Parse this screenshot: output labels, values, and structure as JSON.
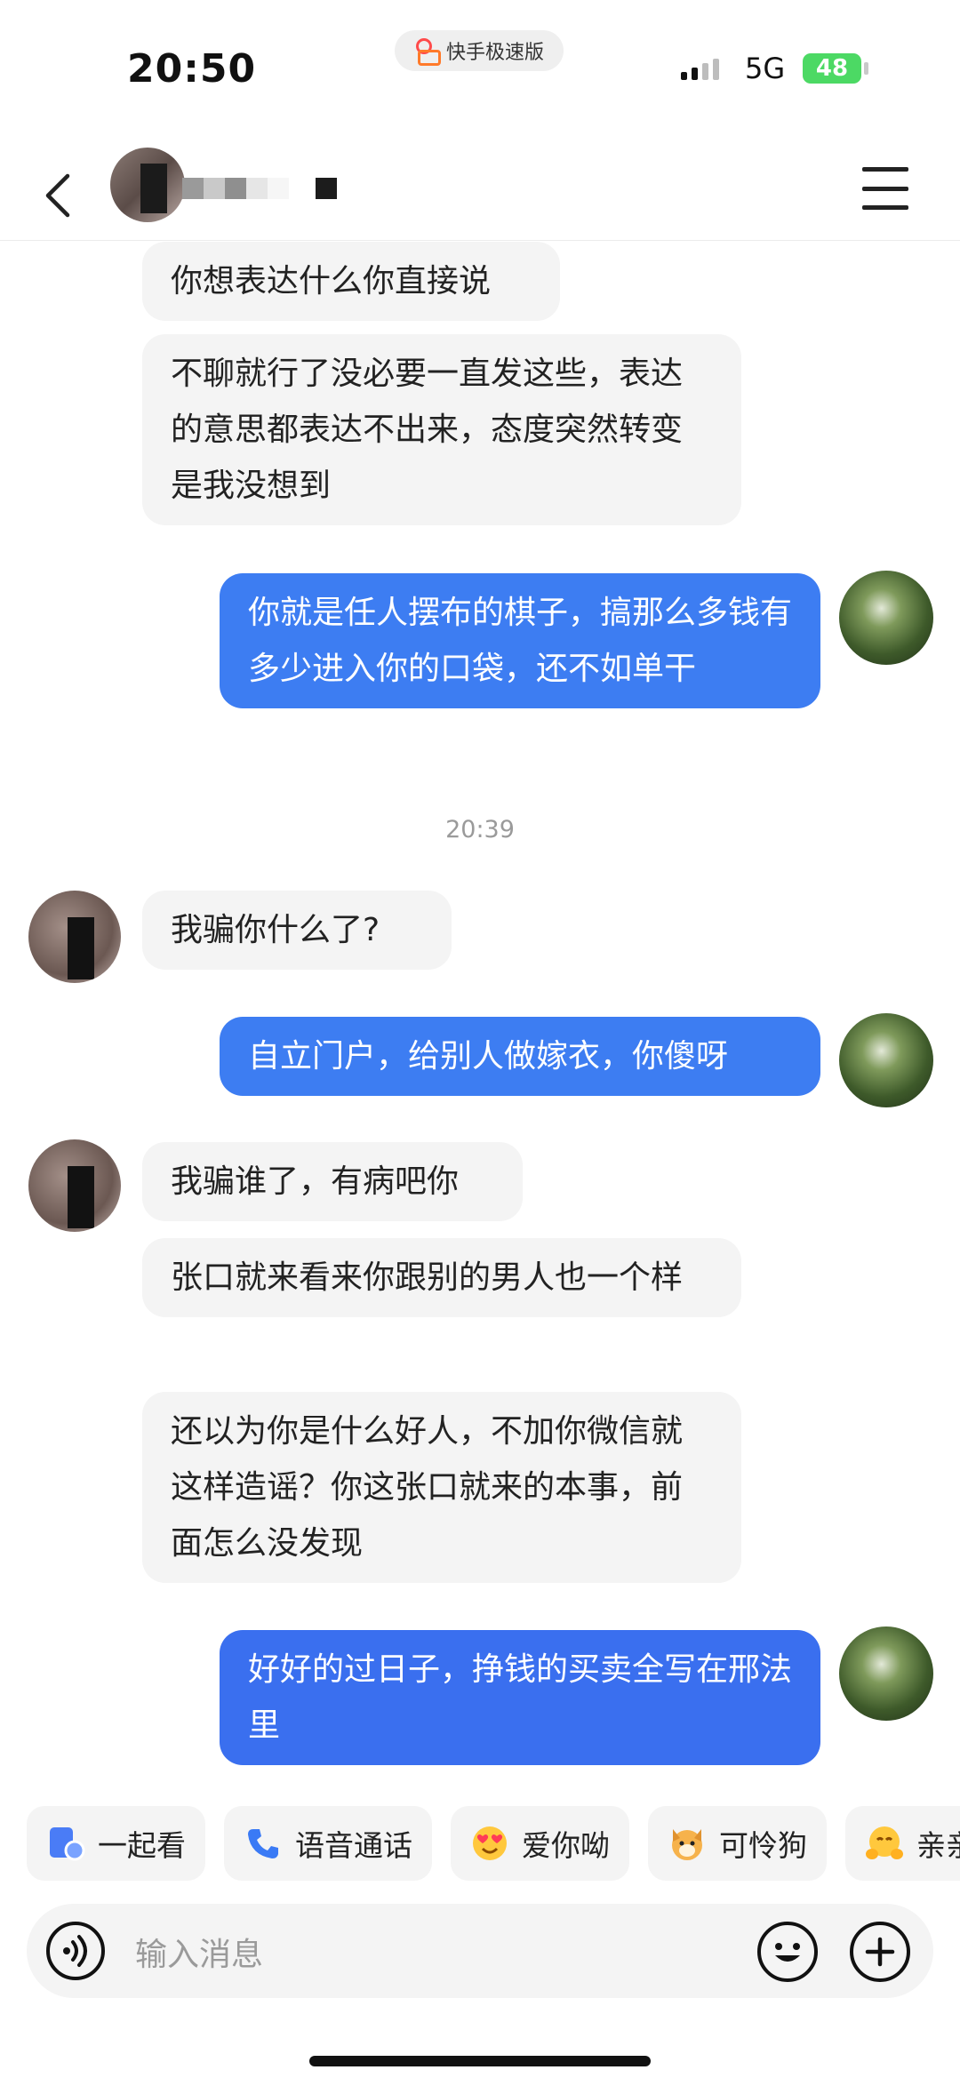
{
  "status": {
    "time": "20:50",
    "app_name": "快手极速版",
    "network": "5G",
    "battery": "48"
  },
  "header": {
    "back_icon": "chevron-left-icon",
    "menu_icon": "hamburger-menu-icon"
  },
  "messages": {
    "m1": "你想表达什么你直接说",
    "m2": "不聊就行了没必要一直发这些，表达的意思都表达不出来，态度突然转变是我没想到",
    "m3": "你就是任人摆布的棋子，搞那么多钱有多少进入你的口袋，还不如单干",
    "time_divider": "20:39",
    "m4": "我骗你什么了?",
    "m5": "自立门户，给别人做嫁衣，你傻呀",
    "m6": "我骗谁了，有病吧你",
    "m7": "张口就来看来你跟别的男人也一个样",
    "m8": "还以为你是什么好人，不加你微信就这样造谣？你这张口就来的本事，前面怎么没发现",
    "m9": "好好的过日子，挣钱的买卖全写在邢法里"
  },
  "quick_actions": [
    "一起看",
    "语音通话",
    "爱你呦",
    "可怜狗",
    "亲亲"
  ],
  "input": {
    "placeholder": "输入消息"
  },
  "colors": {
    "outgoing_bubble": "#3d7df2",
    "incoming_bubble": "#f4f4f4",
    "battery": "#4cd964"
  }
}
